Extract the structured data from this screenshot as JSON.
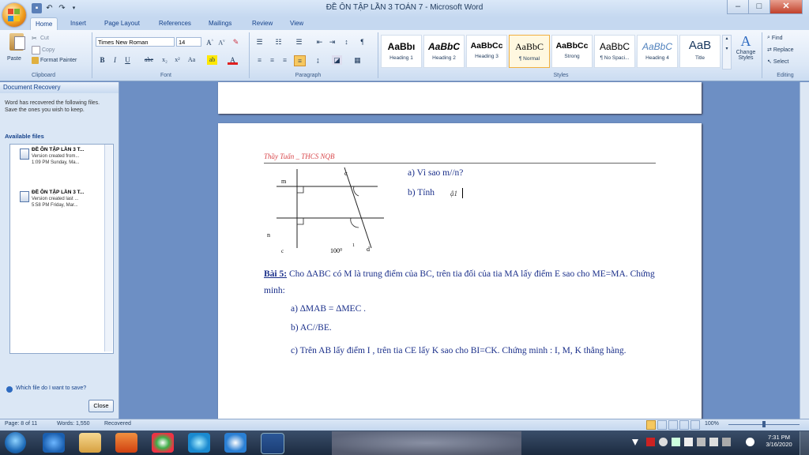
{
  "window": {
    "title": "ĐỀ ÔN TẬP LẦN 3 TOÁN 7 - Microsoft Word",
    "minimize": "–",
    "maximize": "□",
    "close": "✕"
  },
  "tabs": [
    "Home",
    "Insert",
    "Page Layout",
    "References",
    "Mailings",
    "Review",
    "View"
  ],
  "ribbon": {
    "clipboard": {
      "paste": "Paste",
      "cut": "Cut",
      "copy": "Copy",
      "format_painter": "Format Painter",
      "label": "Clipboard"
    },
    "font": {
      "name": "Times New Roman",
      "size": "14",
      "label": "Font"
    },
    "paragraph": {
      "label": "Paragraph"
    },
    "styles": {
      "label": "Styles",
      "items": [
        {
          "preview": "AaBbı",
          "name": "Heading 1"
        },
        {
          "preview": "AaBbC",
          "name": "Heading 2"
        },
        {
          "preview": "AaBbCc",
          "name": "Heading 3"
        },
        {
          "preview": "AaBbC",
          "name": "¶ Normal"
        },
        {
          "preview": "AaBbCc",
          "name": "Strong"
        },
        {
          "preview": "AaBbC",
          "name": "¶ No Spaci..."
        },
        {
          "preview": "AaBbC",
          "name": "Heading 4"
        },
        {
          "preview": "AaB",
          "name": "Title"
        }
      ],
      "change_styles": "Change Styles"
    },
    "editing": {
      "find": "Find",
      "replace": "Replace",
      "select": "Select",
      "label": "Editing"
    }
  },
  "recovery": {
    "title": "Document Recovery",
    "message": "Word has recovered the following files. Save the ones you wish to keep.",
    "available": "Available files",
    "files": [
      {
        "name": "ĐỀ ÔN TẬP LẦN 3 T...",
        "line1": "Version created from...",
        "line2": "1:09 PM Sunday, Ma..."
      },
      {
        "name": "ĐỀ ÔN TẬP LẦN 3 T...",
        "line1": "Version created last ...",
        "line2": "5:58 PM Friday, Mar..."
      }
    ],
    "which_file": "Which file do I want to save?",
    "close": "Close"
  },
  "document": {
    "header": "Thầy Tuấn _ THCS NQB",
    "q_a": "a) Vì sao m//n?",
    "q_b": "b) Tính",
    "figure_labels": {
      "m": "m",
      "n": "n",
      "c": "c",
      "d": "d",
      "angle": "100⁰",
      "one": "1"
    },
    "bai5_title": "Bài 5:",
    "bai5_text": " Cho ∆ABC  có M là trung điểm của BC, trên tia đối của tia MA lấy điểm E sao cho ME=MA. Chứng minh:",
    "part_a": "a) ∆MAB = ∆MEC .",
    "part_b": "b) AC//BE.",
    "part_c": "c) Trên AB lấy điểm I , trên tia CE lấy K sao cho BI=CK. Chứng minh : I, M, K thẳng hàng."
  },
  "status": {
    "page": "Page: 8 of 11",
    "words": "Words: 1,550",
    "recovered": "Recovered",
    "zoom": "100%"
  },
  "taskbar": {
    "time": "7:31 PM",
    "date": "3/16/2020"
  }
}
